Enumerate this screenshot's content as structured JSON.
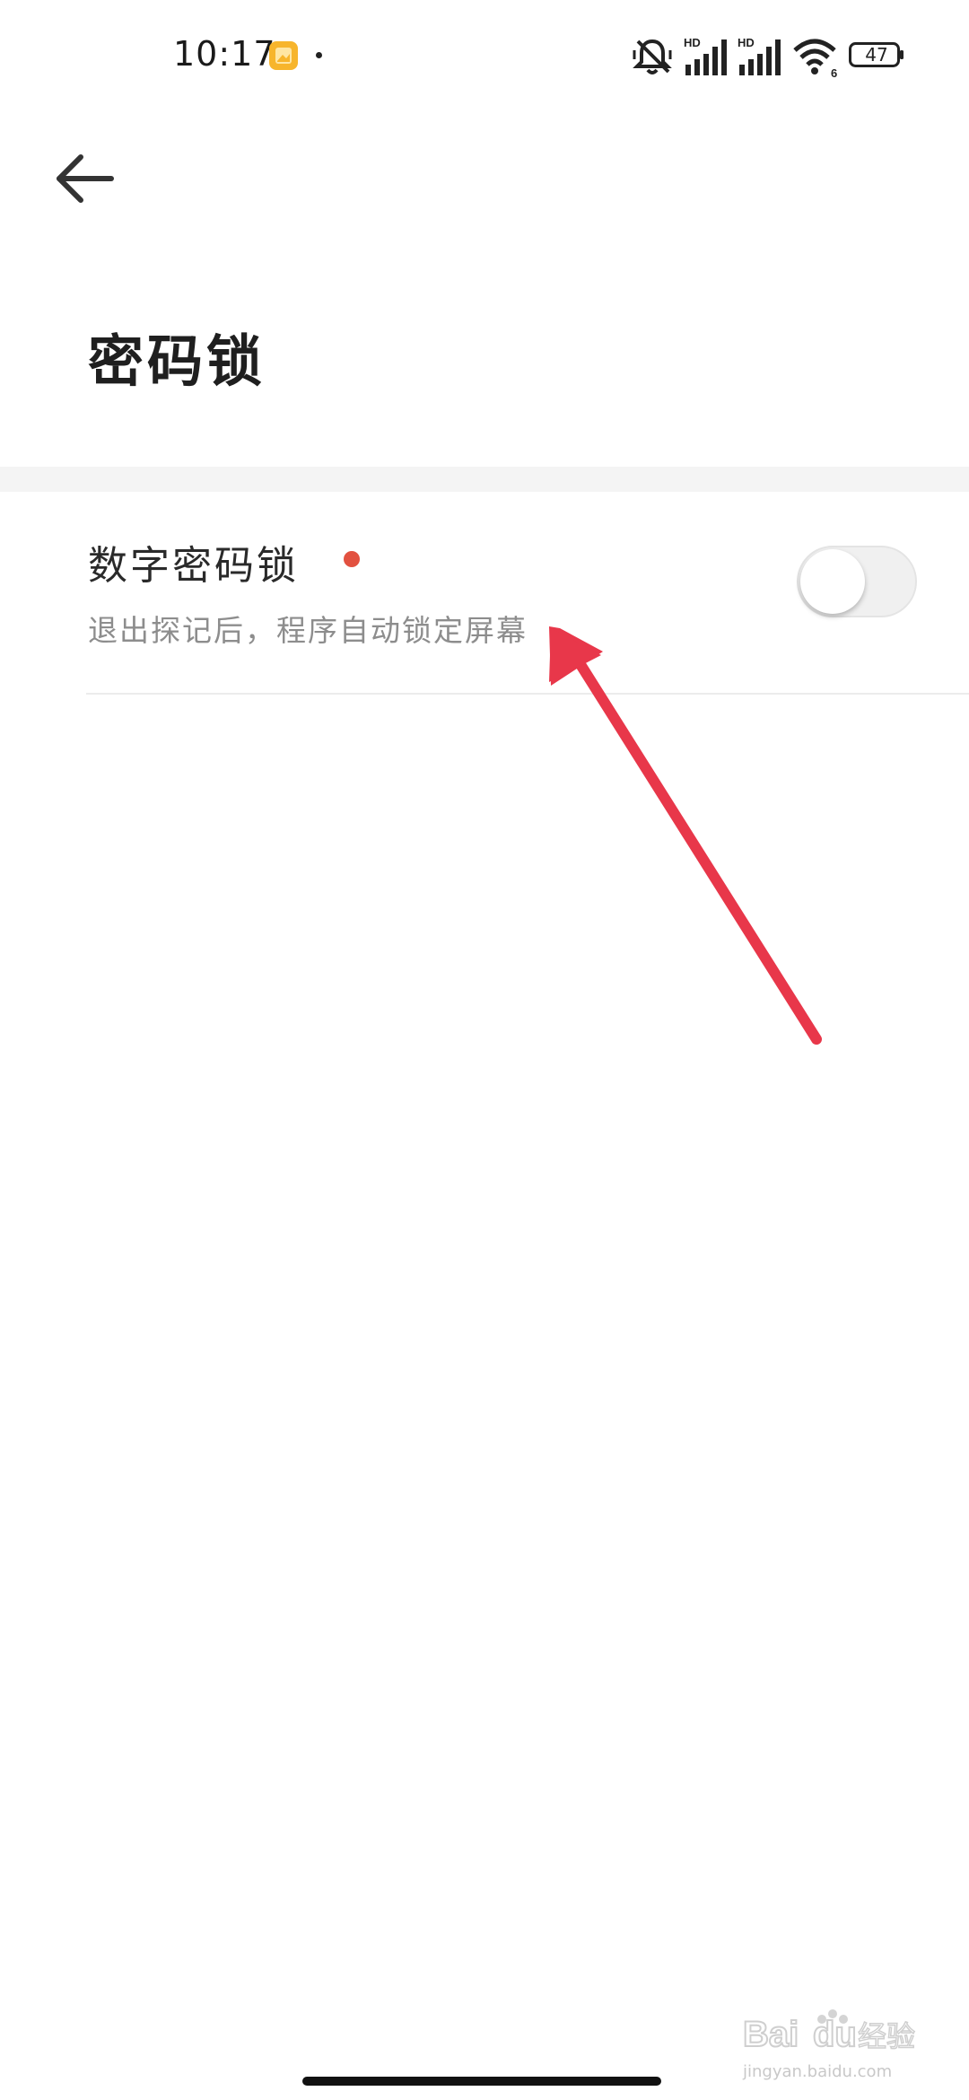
{
  "status_bar": {
    "time": "10:17",
    "battery": "47",
    "icons": [
      "gallery-notification-icon",
      "mute-icon",
      "hd-signal-icon",
      "hd-signal-icon",
      "wifi-6-icon",
      "battery-icon"
    ]
  },
  "header": {
    "back_icon": "arrow-left-icon",
    "title": "密码锁"
  },
  "settings": {
    "numeric_lock": {
      "title": "数字密码锁",
      "description": "退出探记后，程序自动锁定屏幕",
      "enabled": false,
      "has_new_dot": true
    }
  },
  "colors": {
    "accent_dot": "#e25140",
    "annotation_arrow": "#e8374a"
  },
  "watermark": {
    "logo": "Baidu经验",
    "url": "jingyan.baidu.com"
  }
}
